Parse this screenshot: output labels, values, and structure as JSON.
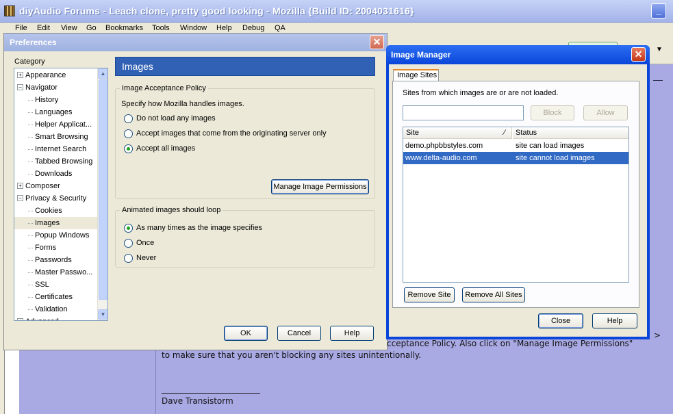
{
  "window": {
    "title": "diyAudio Forums - Leach clone, pretty good looking - Mozilla {Build ID: 2004031616}"
  },
  "menu": [
    "File",
    "Edit",
    "View",
    "Go",
    "Bookmarks",
    "Tools",
    "Window",
    "Help",
    "Debug",
    "QA"
  ],
  "page": {
    "line1_tail": ">",
    "line2": "cceptance Policy. Also click on \"Manage Image Permissions\"",
    "line3": "to make sure that you aren't blocking any sites unintentionally.",
    "signature": "Dave Transistorm"
  },
  "preferences": {
    "title": "Preferences",
    "category_label": "Category",
    "tree": [
      {
        "label": "Appearance",
        "level": 0,
        "expander": "+"
      },
      {
        "label": "Navigator",
        "level": 0,
        "expander": "-"
      },
      {
        "label": "History",
        "level": 1
      },
      {
        "label": "Languages",
        "level": 1
      },
      {
        "label": "Helper Applicat...",
        "level": 1
      },
      {
        "label": "Smart Browsing",
        "level": 1
      },
      {
        "label": "Internet Search",
        "level": 1
      },
      {
        "label": "Tabbed Browsing",
        "level": 1
      },
      {
        "label": "Downloads",
        "level": 1
      },
      {
        "label": "Composer",
        "level": 0,
        "expander": "+"
      },
      {
        "label": "Privacy & Security",
        "level": 0,
        "expander": "-"
      },
      {
        "label": "Cookies",
        "level": 1
      },
      {
        "label": "Images",
        "level": 1,
        "selected": true
      },
      {
        "label": "Popup Windows",
        "level": 1
      },
      {
        "label": "Forms",
        "level": 1
      },
      {
        "label": "Passwords",
        "level": 1
      },
      {
        "label": "Master Passwo...",
        "level": 1
      },
      {
        "label": "SSL",
        "level": 1
      },
      {
        "label": "Certificates",
        "level": 1
      },
      {
        "label": "Validation",
        "level": 1
      },
      {
        "label": "Advanced",
        "level": 0,
        "expander": "+"
      }
    ],
    "panel_title": "Images",
    "acceptance_group": "Image Acceptance Policy",
    "acceptance_desc": "Specify how Mozilla handles images.",
    "acceptance_options": [
      "Do not load any images",
      "Accept images that come from the originating server only",
      "Accept all images"
    ],
    "acceptance_selected": 2,
    "manage_button": "Manage Image Permissions",
    "loop_group": "Animated images should loop",
    "loop_options": [
      "As many times as the image specifies",
      "Once",
      "Never"
    ],
    "loop_selected": 0,
    "ok": "OK",
    "cancel": "Cancel",
    "help": "Help"
  },
  "image_manager": {
    "title": "Image Manager",
    "tab": "Image Sites",
    "desc": "Sites from which images are or are not loaded.",
    "input_value": "",
    "block": "Block",
    "allow": "Allow",
    "col_site": "Site",
    "col_status": "Status",
    "rows": [
      {
        "site": "demo.phpbbstyles.com",
        "status": "site can load images",
        "selected": false
      },
      {
        "site": "www.delta-audio.com",
        "status": "site cannot load images",
        "selected": true
      }
    ],
    "remove_site": "Remove Site",
    "remove_all": "Remove All Sites",
    "close": "Close",
    "help": "Help"
  },
  "colors": {
    "selection": "#316ac5",
    "panel_header": "#3161b5",
    "page_bg": "#a9a9e4"
  }
}
